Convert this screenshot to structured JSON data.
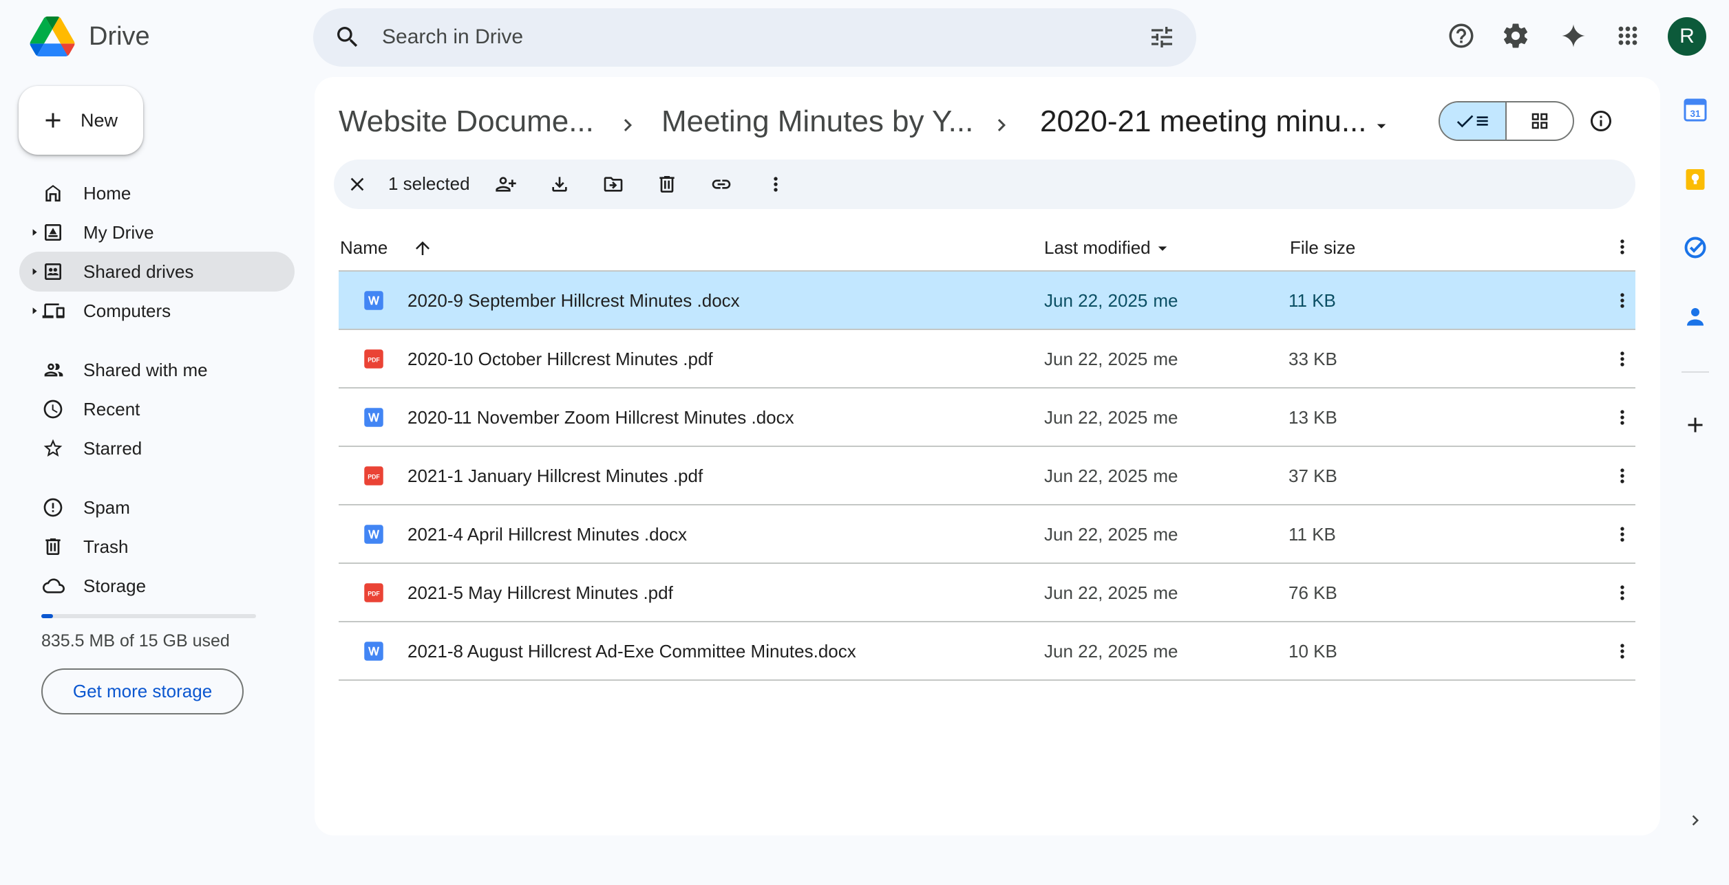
{
  "app": {
    "name": "Drive"
  },
  "search": {
    "placeholder": "Search in Drive"
  },
  "header_icons": [
    "help-icon",
    "settings-icon",
    "gemini-icon",
    "apps-grid-icon"
  ],
  "account": {
    "initial": "R",
    "color": "#0c5a3a"
  },
  "sidebar": {
    "new_label": "New",
    "items": [
      {
        "label": "Home",
        "icon": "home-icon",
        "expandable": false,
        "active": false
      },
      {
        "label": "My Drive",
        "icon": "my-drive-icon",
        "expandable": true,
        "active": false
      },
      {
        "label": "Shared drives",
        "icon": "shared-drives-icon",
        "expandable": true,
        "active": true
      },
      {
        "label": "Computers",
        "icon": "computers-icon",
        "expandable": true,
        "active": false
      },
      {
        "label": "Shared with me",
        "icon": "shared-with-me-icon",
        "expandable": false,
        "active": false
      },
      {
        "label": "Recent",
        "icon": "clock-icon",
        "expandable": false,
        "active": false
      },
      {
        "label": "Starred",
        "icon": "star-icon",
        "expandable": false,
        "active": false
      },
      {
        "label": "Spam",
        "icon": "spam-icon",
        "expandable": false,
        "active": false
      },
      {
        "label": "Trash",
        "icon": "trash-icon",
        "expandable": false,
        "active": false
      },
      {
        "label": "Storage",
        "icon": "cloud-icon",
        "expandable": false,
        "active": false
      }
    ],
    "storage": {
      "used_text": "835.5 MB of 15 GB used",
      "used_fraction": 0.054,
      "cta_label": "Get more storage"
    }
  },
  "breadcrumbs": [
    {
      "label": "Website Docume..."
    },
    {
      "label": "Meeting Minutes by Y..."
    },
    {
      "label": "2020-21 meeting minu..."
    }
  ],
  "selection_bar": {
    "count_text": "1 selected",
    "actions": [
      "share-icon",
      "download-icon",
      "move-icon",
      "delete-icon",
      "copy-link-icon",
      "more-actions-icon"
    ]
  },
  "table": {
    "columns": {
      "name": "Name",
      "modified": "Last modified",
      "size": "File size"
    },
    "rows": [
      {
        "type": "docx",
        "name": "2020-9 September Hillcrest Minutes .docx",
        "modified": "Jun 22, 2025",
        "owner": "me",
        "size": "11 KB",
        "selected": true
      },
      {
        "type": "pdf",
        "name": "2020-10 October Hillcrest Minutes .pdf",
        "modified": "Jun 22, 2025",
        "owner": "me",
        "size": "33 KB",
        "selected": false
      },
      {
        "type": "docx",
        "name": "2020-11 November Zoom Hillcrest Minutes .docx",
        "modified": "Jun 22, 2025",
        "owner": "me",
        "size": "13 KB",
        "selected": false
      },
      {
        "type": "pdf",
        "name": "2021-1 January Hillcrest Minutes .pdf",
        "modified": "Jun 22, 2025",
        "owner": "me",
        "size": "37 KB",
        "selected": false
      },
      {
        "type": "docx",
        "name": "2021-4 April Hillcrest Minutes .docx",
        "modified": "Jun 22, 2025",
        "owner": "me",
        "size": "11 KB",
        "selected": false
      },
      {
        "type": "pdf",
        "name": "2021-5 May Hillcrest Minutes .pdf",
        "modified": "Jun 22, 2025",
        "owner": "me",
        "size": "76 KB",
        "selected": false
      },
      {
        "type": "docx",
        "name": "2021-8 August Hillcrest Ad-Exe Committee Minutes.docx",
        "modified": "Jun 22, 2025",
        "owner": "me",
        "size": "10 KB",
        "selected": false
      }
    ]
  },
  "side_panel": {
    "apps": [
      "calendar-icon",
      "keep-icon",
      "tasks-icon",
      "contacts-icon"
    ],
    "calendar_day": "31"
  },
  "colors": {
    "accent": "#0b57d0",
    "selected_row": "#c2e7ff",
    "docx_icon": "#4285f4",
    "pdf_icon": "#ea4335"
  }
}
